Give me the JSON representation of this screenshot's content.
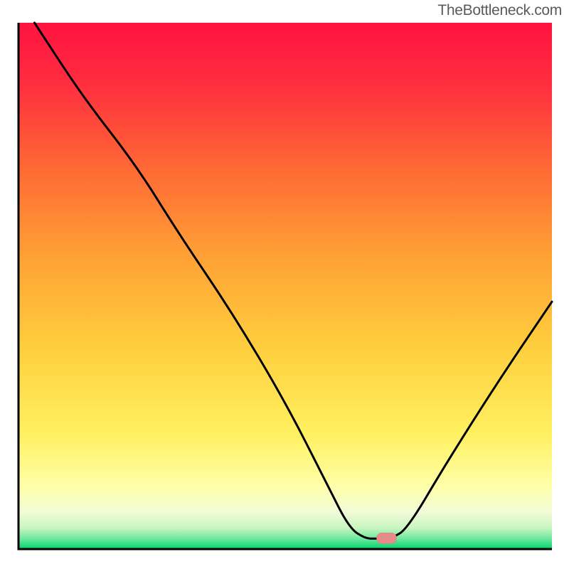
{
  "watermark": "TheBottleneck.com",
  "chart_data": {
    "type": "line",
    "title": "",
    "xlabel": "",
    "ylabel": "",
    "x_range": [
      0,
      100
    ],
    "y_range": [
      0,
      100
    ],
    "gradient": {
      "top": "#ff1a3e",
      "upper_mid": "#ff8c2e",
      "mid": "#ffd740",
      "lower_mid": "#ffff70",
      "low": "#f6fcd0",
      "bottom": "#00d870"
    },
    "curve": [
      {
        "x": 3,
        "y": 100
      },
      {
        "x": 12,
        "y": 86
      },
      {
        "x": 22,
        "y": 73
      },
      {
        "x": 30,
        "y": 60
      },
      {
        "x": 40,
        "y": 45
      },
      {
        "x": 50,
        "y": 28
      },
      {
        "x": 58,
        "y": 12
      },
      {
        "x": 62,
        "y": 4
      },
      {
        "x": 65,
        "y": 2
      },
      {
        "x": 67,
        "y": 2
      },
      {
        "x": 70,
        "y": 2
      },
      {
        "x": 73,
        "y": 4
      },
      {
        "x": 80,
        "y": 16
      },
      {
        "x": 90,
        "y": 32
      },
      {
        "x": 100,
        "y": 47
      }
    ],
    "marker": {
      "x": 69,
      "y": 2,
      "color": "#e88a8a"
    },
    "annotations": []
  }
}
